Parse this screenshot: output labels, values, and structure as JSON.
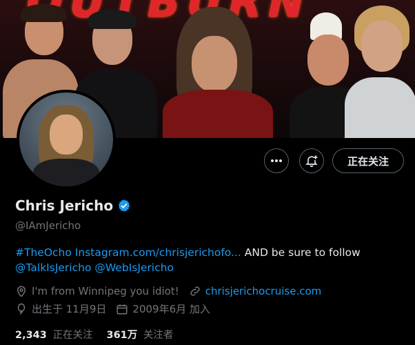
{
  "banner": {
    "logo_text": "OUTBURN"
  },
  "profile": {
    "name": "Chris Jericho",
    "handle": "@IAmJericho",
    "verified": true,
    "accent_color": "#1d9bf0"
  },
  "actions": {
    "more_icon": "ellipsis-icon",
    "notify_icon": "bell-plus-icon",
    "follow_label": "正在关注"
  },
  "bio": {
    "hashtag": "#TheOcho",
    "link": "Instagram.com/chrisjerichofo...",
    "text": "AND be sure to follow",
    "mention1": "@TalkIsJericho",
    "mention2": "@WebIsJericho"
  },
  "meta": {
    "location": "I'm from Winnipeg you idiot!",
    "website": "chrisjerichocruise.com",
    "birthday": "出生于 11月9日",
    "joined": "2009年6月 加入"
  },
  "stats": {
    "following_count": "2,343",
    "following_label": "正在关注",
    "followers_count": "361万",
    "followers_label": "关注者"
  }
}
